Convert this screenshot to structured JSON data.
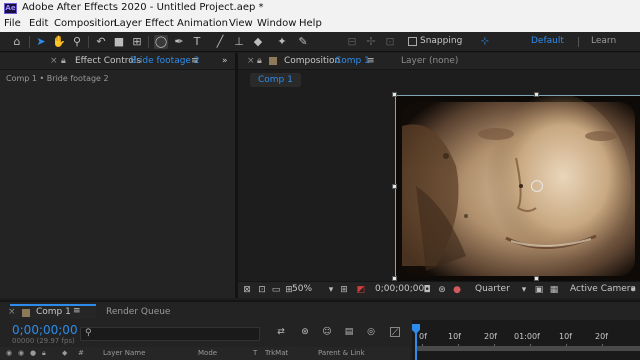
{
  "app": {
    "badge": "Ae",
    "title": "Adobe After Effects 2020 - Untitled Project.aep *"
  },
  "menu": [
    "File",
    "Edit",
    "Composition",
    "Layer",
    "Effect",
    "Animation",
    "View",
    "Window",
    "Help"
  ],
  "toolbar": {
    "tools": [
      "home-icon",
      "selection-arrow-icon",
      "hand-icon",
      "zoom-icon",
      "rotate-icon",
      "camera-icon",
      "pan-behind-icon",
      "ellipse-tool-icon",
      "pen-icon",
      "type-icon",
      "brush-icon",
      "clone-stamp-icon",
      "eraser-icon",
      "roto-brush-icon",
      "puppet-pin-icon"
    ],
    "snapping_label": "Snapping",
    "workspace_default": "Default",
    "workspace_learn": "Learn"
  },
  "effect_controls": {
    "tab_label": "Effect Controls",
    "tab_target": "Bride footage 2",
    "breadcrumb": "Comp 1 • Bride footage 2"
  },
  "composition": {
    "tab_label": "Composition",
    "tab_target": "Comp 1",
    "layer_label": "Layer (none)",
    "comp_tab": "Comp 1"
  },
  "viewer_bar": {
    "zoom": "50%",
    "timecode": "0;00;00;00",
    "resolution": "Quarter",
    "camera": "Active Camera"
  },
  "timeline": {
    "tab_label": "Comp 1",
    "render_queue_label": "Render Queue",
    "timecode": "0;00;00;00",
    "fps": "00000 (29.97 fps)",
    "columns": [
      "Layer Name",
      "Mode",
      "T",
      "TrkMat",
      "Parent & Link"
    ],
    "ruler_labels": [
      "0f",
      "10f",
      "20f",
      "01:00f",
      "10f",
      "20f"
    ]
  },
  "colors": {
    "accent": "#2d8ceb",
    "panel_bg": "#232323",
    "viewer_bg": "#1d1d1d",
    "menu_bg": "#f2f2f2"
  }
}
